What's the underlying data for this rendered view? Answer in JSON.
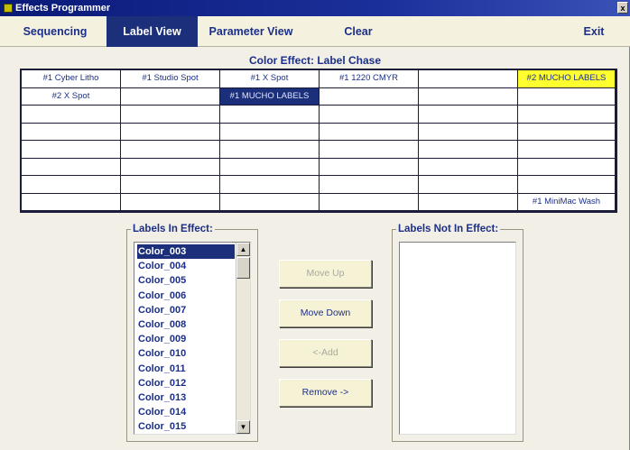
{
  "window": {
    "title": "Effects Programmer",
    "close_glyph": "x"
  },
  "menu": {
    "items": [
      {
        "label": "Sequencing",
        "active": false
      },
      {
        "label": "Label View",
        "active": true
      },
      {
        "label": "Parameter View",
        "active": false
      },
      {
        "label": "Clear",
        "active": false
      },
      {
        "label": "Exit",
        "active": false
      }
    ]
  },
  "effect": {
    "title": "Color Effect: Label Chase"
  },
  "grid": {
    "rows": [
      [
        "#1 Cyber Litho",
        "#1 Studio Spot",
        "#1 X Spot",
        "#1 1220 CMYR",
        "",
        "#2 MUCHO LABELS"
      ],
      [
        "#2 X Spot",
        "",
        "#1 MUCHO LABELS",
        "",
        "",
        ""
      ],
      [
        "",
        "",
        "",
        "",
        "",
        ""
      ],
      [
        "",
        "",
        "",
        "",
        "",
        ""
      ],
      [
        "",
        "",
        "",
        "",
        "",
        ""
      ],
      [
        "",
        "",
        "",
        "",
        "",
        ""
      ],
      [
        "",
        "",
        "",
        "",
        "",
        ""
      ],
      [
        "",
        "",
        "",
        "",
        "",
        "#1 MiniMac Wash"
      ]
    ],
    "highlight_selected": {
      "row": 1,
      "col": 2
    },
    "highlight_yellow": {
      "row": 0,
      "col": 5
    }
  },
  "labels_in_effect": {
    "title": "Labels In Effect:",
    "items": [
      "Color_003",
      "Color_004",
      "Color_005",
      "Color_006",
      "Color_007",
      "Color_008",
      "Color_009",
      "Color_010",
      "Color_011",
      "Color_012",
      "Color_013",
      "Color_014",
      "Color_015"
    ],
    "selected_index": 0,
    "scroll_up": "▲",
    "scroll_down": "▼"
  },
  "labels_not_in_effect": {
    "title": "Labels Not In Effect:",
    "items": []
  },
  "buttons": {
    "move_up": "Move Up",
    "move_down": "Move Down",
    "add": "<-Add",
    "remove": "Remove ->"
  }
}
